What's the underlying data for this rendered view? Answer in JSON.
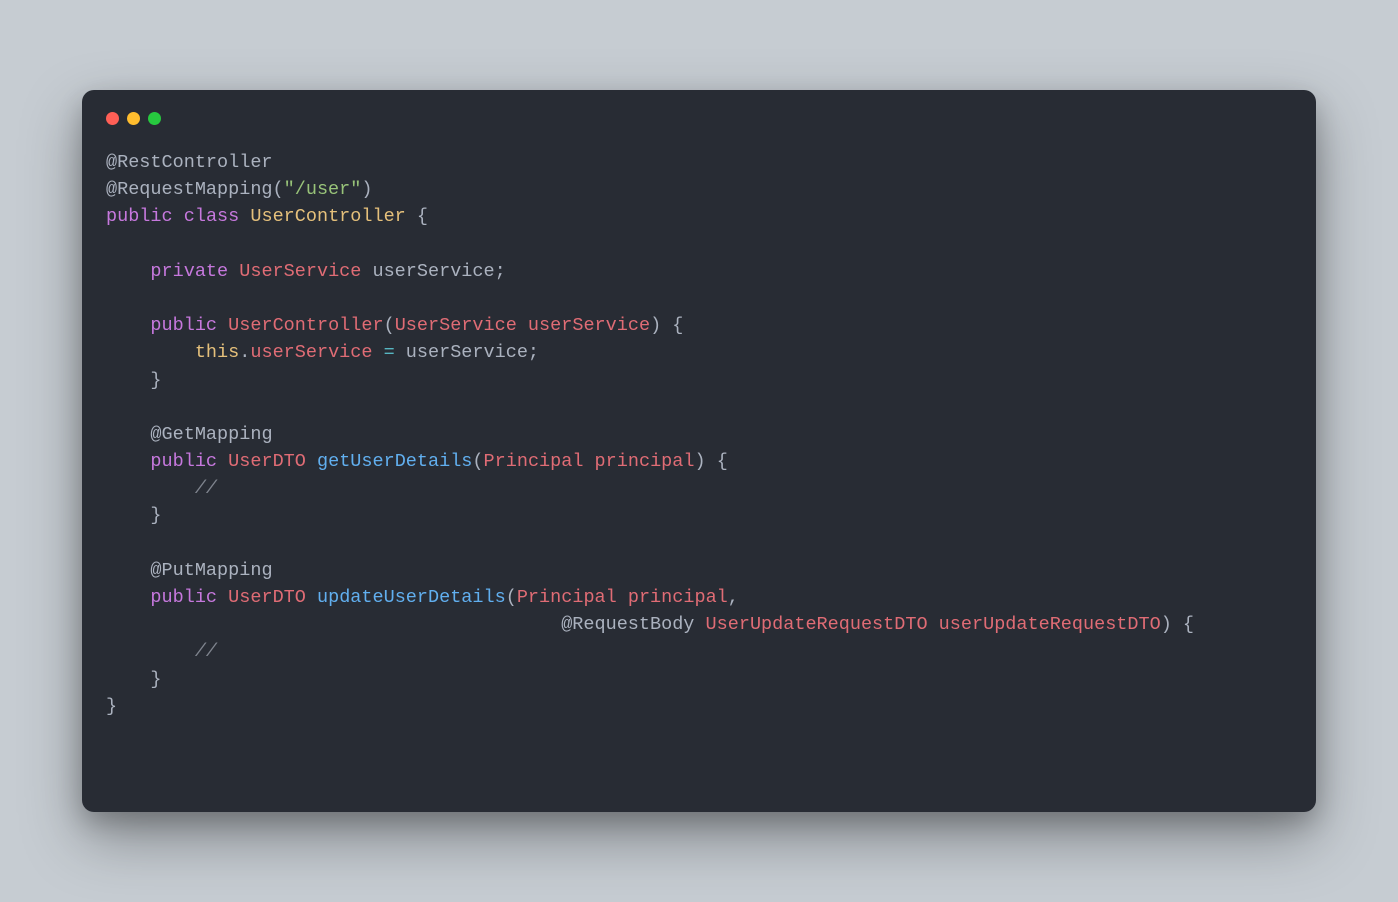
{
  "colors": {
    "background": "#282c34",
    "page_bg": "#c6ccd2",
    "red": "#ff5f56",
    "yellow": "#ffbd2e",
    "green": "#27c93f",
    "text": "#abb2bf",
    "keyword": "#c678dd",
    "string": "#98c379",
    "classname": "#e5c07b",
    "type": "#e06c75",
    "method": "#61afef",
    "comment": "#7f848e",
    "operator": "#56b6c2"
  },
  "code": {
    "l1_anno": "@RestController",
    "l2_anno": "@RequestMapping",
    "l2_paren_open": "(",
    "l2_str": "\"/user\"",
    "l2_paren_close": ")",
    "l3_kw1": "public",
    "l3_kw2": "class",
    "l3_class": "UserController",
    "l3_brace": " {",
    "l5_kw": "private",
    "l5_type": "UserService",
    "l5_field": " userService",
    "l5_semi": ";",
    "l7_kw": "public",
    "l7_ctor": "UserController",
    "l7_po": "(",
    "l7_ptype": "UserService",
    "l7_pname": " userService",
    "l7_pc": ")",
    "l7_brace": " {",
    "l8_this": "this",
    "l8_dot": ".",
    "l8_field": "userService",
    "l8_op": " = ",
    "l8_val": "userService",
    "l8_semi": ";",
    "l9_close": "}",
    "l11_anno": "@GetMapping",
    "l12_kw": "public",
    "l12_ret": "UserDTO",
    "l12_method": "getUserDetails",
    "l12_po": "(",
    "l12_ptype": "Principal",
    "l12_pname": " principal",
    "l12_pc": ")",
    "l12_brace": " {",
    "l13_comment": "//",
    "l14_close": "}",
    "l16_anno": "@PutMapping",
    "l17_kw": "public",
    "l17_ret": "UserDTO",
    "l17_method": "updateUserDetails",
    "l17_po": "(",
    "l17_ptype": "Principal",
    "l17_pname": " principal",
    "l17_comma": ",",
    "l18_anno": "@RequestBody",
    "l18_ptype": "UserUpdateRequestDTO",
    "l18_pname": " userUpdateRequestDTO",
    "l18_pc": ")",
    "l18_brace": " {",
    "l19_comment": "//",
    "l20_close": "}",
    "l21_close": "}",
    "indent1": "    ",
    "indent2": "        ",
    "indent_align": "                                         "
  }
}
